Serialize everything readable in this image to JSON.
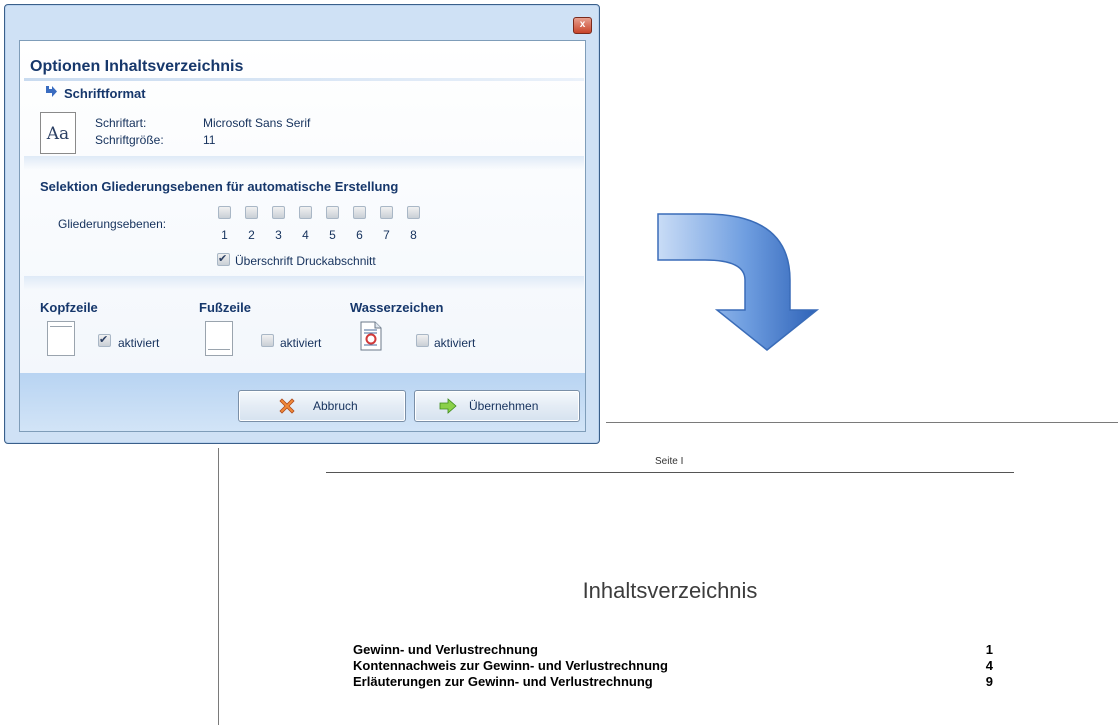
{
  "dialog": {
    "close_label": "x",
    "title": "Optionen Inhaltsverzeichnis",
    "font_section": {
      "heading": "Schriftformat",
      "icon_label": "Aa",
      "font_label": "Schriftart:",
      "font_value": "Microsoft Sans Serif",
      "size_label": "Schriftgröße:",
      "size_value": "11"
    },
    "levels_section": {
      "heading": "Selektion Gliederungsebenen für automatische Erstellung",
      "label": "Gliederungsebenen:",
      "levels": [
        "1",
        "2",
        "3",
        "4",
        "5",
        "6",
        "7",
        "8"
      ],
      "print_heading_label": "Überschrift Druckabschnitt",
      "print_heading_checked": true
    },
    "header": {
      "heading": "Kopfzeile",
      "checkbox_label": "aktiviert",
      "checked": true
    },
    "footer": {
      "heading": "Fußzeile",
      "checkbox_label": "aktiviert",
      "checked": false
    },
    "watermark": {
      "heading": "Wasserzeichen",
      "checkbox_label": "aktiviert",
      "checked": false
    },
    "buttons": {
      "cancel": "Abbruch",
      "apply": "Übernehmen"
    }
  },
  "document": {
    "page_header": "Seite I",
    "toc_title": "Inhaltsverzeichnis",
    "entries": [
      {
        "title": "Gewinn- und Verlustrechnung",
        "page": "1"
      },
      {
        "title": "Kontennachweis zur Gewinn- und Verlustrechnung",
        "page": "4"
      },
      {
        "title": "Erläuterungen zur Gewinn- und Verlustrechnung",
        "page": "9"
      }
    ]
  },
  "colors": {
    "accent": "#16376b",
    "arrow": "#4a7fcc",
    "dialog_bg": "#cfe1f5"
  }
}
